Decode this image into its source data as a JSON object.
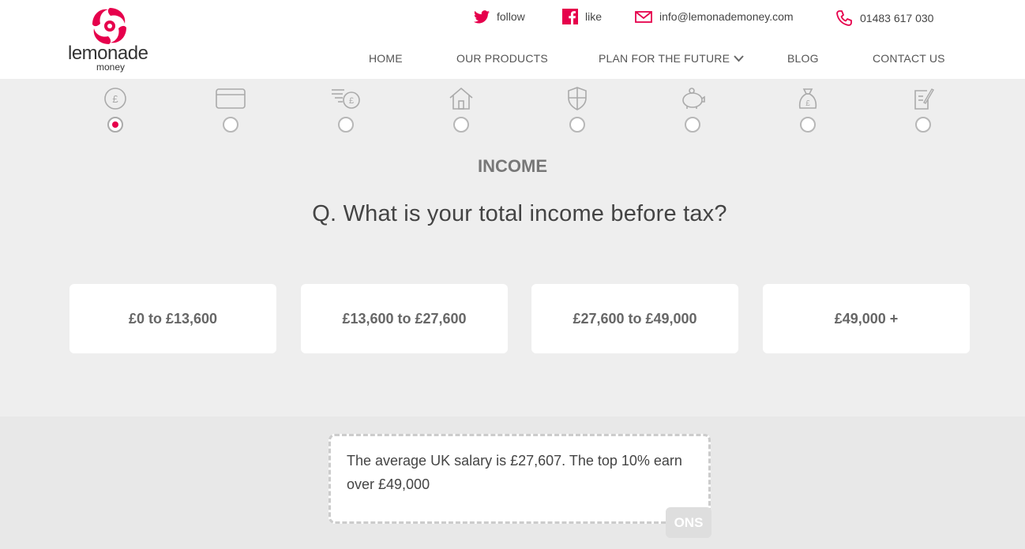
{
  "brand": {
    "name": "lemonade",
    "sub": "money",
    "accent": "#e6004c"
  },
  "top_links": {
    "follow": "follow",
    "like": "like",
    "email": "info@lemonademoney.com",
    "phone": "01483 617 030"
  },
  "nav": {
    "home": "HOME",
    "products": "OUR PRODUCTS",
    "plan": "PLAN FOR THE FUTURE",
    "blog": "BLOG",
    "contact": "CONTACT US"
  },
  "steps": [
    {
      "icon": "pound-coin-icon",
      "active": true
    },
    {
      "icon": "credit-card-icon",
      "active": false
    },
    {
      "icon": "outgoings-icon",
      "active": false
    },
    {
      "icon": "house-icon",
      "active": false
    },
    {
      "icon": "shield-icon",
      "active": false
    },
    {
      "icon": "piggy-bank-icon",
      "active": false
    },
    {
      "icon": "money-bag-icon",
      "active": false
    },
    {
      "icon": "document-icon",
      "active": false
    }
  ],
  "section_title": "INCOME",
  "question": "Q. What is your total income before tax?",
  "options": [
    "£0 to £13,600",
    "£13,600 to £27,600",
    "£27,600 to £49,000",
    "£49,000 +"
  ],
  "info": {
    "text": "The average UK salary is £27,607. The top 10% earn over £49,000",
    "source": "ONS"
  }
}
